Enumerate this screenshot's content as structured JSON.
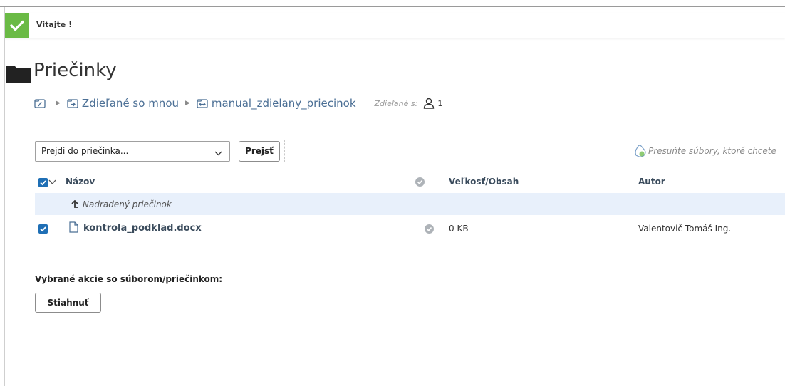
{
  "notification": {
    "message": "Vitajte !",
    "color": "#6aba45"
  },
  "page": {
    "title": "Priečinky"
  },
  "breadcrumb": {
    "items": [
      {
        "label": "",
        "icon": "folder-root-icon"
      },
      {
        "label": "Zdieľané so mnou",
        "icon": "shared-folder-icon"
      },
      {
        "label": "manual_zdielany_priecinok",
        "icon": "shared-link-folder-icon"
      }
    ],
    "shared_label": "Zdieľané s:",
    "shared_count": "1"
  },
  "toolbar": {
    "folder_select_value": "Prejdi do priečinka...",
    "go_button": "Prejsť",
    "dropzone_text": "Presuňte súbory, ktoré chcete"
  },
  "table": {
    "columns": {
      "name": "Názov",
      "size": "Veľkosť/Obsah",
      "author": "Autor"
    },
    "parent_row": "Nadradený priečinok",
    "rows": [
      {
        "name": "kontrola_podklad.docx",
        "size": "0 KB",
        "author": "Valentovič Tomáš Ing.",
        "checked": true
      }
    ]
  },
  "actions": {
    "label": "Vybrané akcie so súborom/priečinkom:",
    "download_button": "Stiahnuť"
  }
}
